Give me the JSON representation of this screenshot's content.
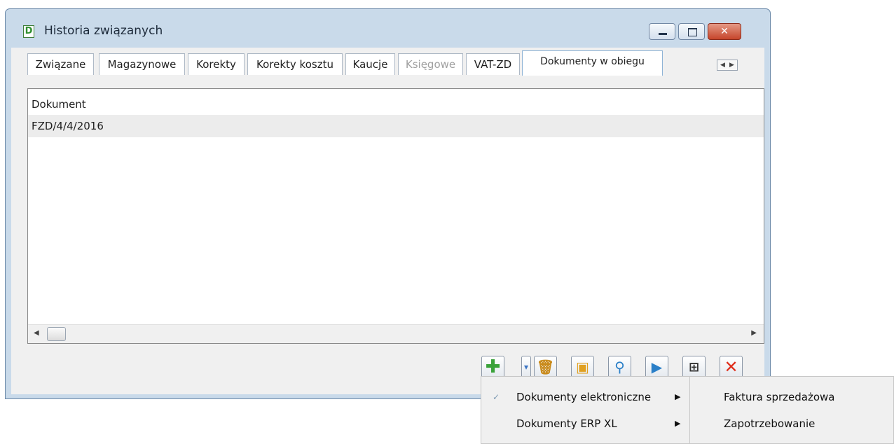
{
  "window": {
    "title": "Historia związanych",
    "controls": {
      "minimize_icon": "minimize-icon",
      "maximize_icon": "maximize-icon",
      "close_icon": "close-icon"
    }
  },
  "tabs": [
    {
      "label": "Związane",
      "state": "normal"
    },
    {
      "label": "Magazynowe",
      "state": "normal"
    },
    {
      "label": "Korekty",
      "state": "normal"
    },
    {
      "label": "Korekty kosztu",
      "state": "normal"
    },
    {
      "label": "Kaucje",
      "state": "normal"
    },
    {
      "label": "Księgowe",
      "state": "disabled"
    },
    {
      "label": "VAT-ZD",
      "state": "normal"
    },
    {
      "label": "Dokumenty w obiegu",
      "state": "active"
    }
  ],
  "grid": {
    "columns": [
      "Dokument"
    ],
    "rows": [
      [
        "FZD/4/4/2016"
      ]
    ]
  },
  "toolbar": {
    "buttons": [
      {
        "icon": "add-icon",
        "color": "#3aa23a"
      },
      {
        "icon": "dropdown-icon",
        "color": "#3b74c4"
      },
      {
        "icon": "trash-icon",
        "color": "#c98a1a"
      },
      {
        "icon": "open-document-icon",
        "color": "#e0a020"
      },
      {
        "icon": "search-icon",
        "color": "#2a7fc8"
      },
      {
        "icon": "link-document-icon",
        "color": "#2a7fc8"
      },
      {
        "icon": "tree-icon",
        "color": "#333333"
      },
      {
        "icon": "close-icon",
        "color": "#e0301e"
      }
    ]
  },
  "context_menu": {
    "items": [
      {
        "label": "Dokumenty elektroniczne",
        "checked": true
      },
      {
        "label": "Dokumenty ERP XL",
        "checked": false
      }
    ],
    "submenu": {
      "items": [
        {
          "label": "Faktura sprzedażowa"
        },
        {
          "label": "Zapotrzebowanie"
        }
      ]
    }
  }
}
